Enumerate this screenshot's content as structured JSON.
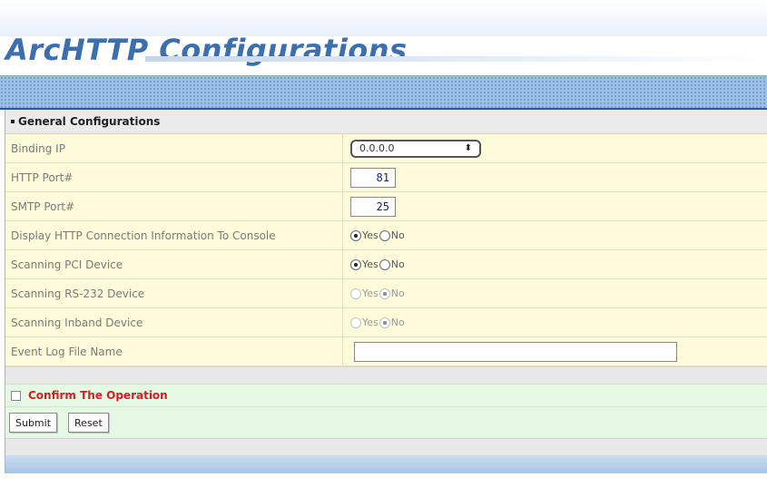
{
  "page": {
    "title": "ArcHTTP Configurations"
  },
  "section": {
    "title": "General Configurations"
  },
  "rows": {
    "binding_ip": {
      "label": "Binding IP",
      "value": "0.0.0.0"
    },
    "http_port": {
      "label": "HTTP Port#",
      "value": "81"
    },
    "smtp_port": {
      "label": "SMTP Port#",
      "value": "25"
    },
    "display_http": {
      "label": "Display HTTP Connection Information To Console",
      "yes": "Yes",
      "no": "No",
      "selected": "Yes"
    },
    "scan_pci": {
      "label": "Scanning PCI Device",
      "yes": "Yes",
      "no": "No",
      "selected": "Yes"
    },
    "scan_rs232": {
      "label": "Scanning RS-232 Device",
      "yes": "Yes",
      "no": "No",
      "selected": "No"
    },
    "scan_inband": {
      "label": "Scanning Inband Device",
      "yes": "Yes",
      "no": "No",
      "selected": "No"
    },
    "event_log": {
      "label": "Event Log File Name",
      "value": ""
    }
  },
  "confirm": {
    "label": "Confirm The Operation"
  },
  "buttons": {
    "submit": "Submit",
    "reset": "Reset"
  },
  "colors": {
    "title": "#3d6fae",
    "confirm": "#d42020",
    "row_bg": "#fdfbd9",
    "button_area_bg": "#e4f8e4"
  }
}
